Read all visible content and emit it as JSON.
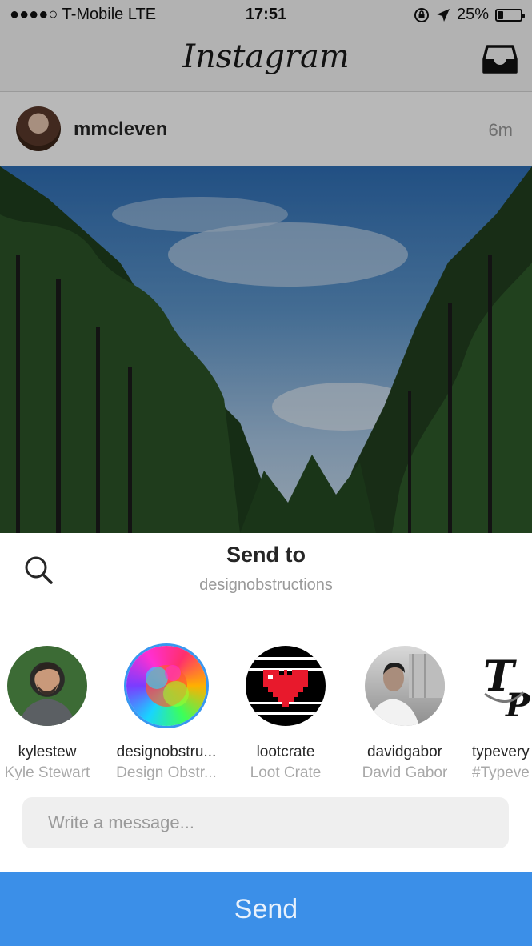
{
  "status_bar": {
    "carrier": "●●●●○ T-Mobile  LTE",
    "time": "17:51",
    "battery": "25%",
    "battery_level": 0.25
  },
  "nav": {
    "logo": "Instagram"
  },
  "post": {
    "username": "mmcleven",
    "time_ago": "6m"
  },
  "share_sheet": {
    "title": "Send to",
    "subtitle": "designobstructions",
    "recipients": [
      {
        "username": "kylestew",
        "full_name": "Kyle Stewart"
      },
      {
        "username": "designobstru...",
        "full_name": "Design Obstr..."
      },
      {
        "username": "lootcrate",
        "full_name": "Loot Crate"
      },
      {
        "username": "davidgabor",
        "full_name": "David Gabor"
      },
      {
        "username": "typevery",
        "full_name": "#Typeve"
      }
    ],
    "message_placeholder": "Write a message...",
    "send_label": "Send"
  },
  "colors": {
    "accent": "#3b8fe8",
    "selected_ring": "#3897f0"
  }
}
